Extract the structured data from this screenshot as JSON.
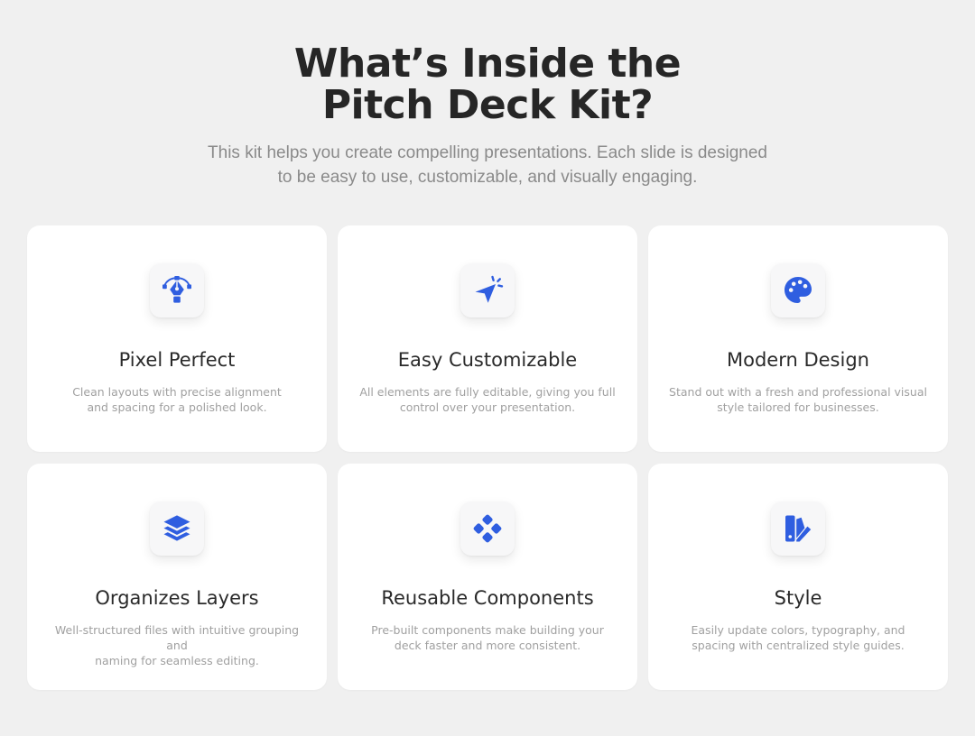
{
  "header": {
    "title_line1": "What’s Inside the",
    "title_line2": "Pitch Deck Kit?",
    "subtitle_line1": "This kit helps you create compelling presentations. Each slide is designed",
    "subtitle_line2": "to be easy to use, customizable, and visually engaging."
  },
  "colors": {
    "accent": "#2f5ee0",
    "background": "#f0f0f0",
    "card": "#ffffff",
    "title": "#262626",
    "muted": "#a0a0a0"
  },
  "features": [
    {
      "icon": "pen-tool-icon",
      "title": "Pixel Perfect",
      "desc_line1": "Clean layouts with precise alignment",
      "desc_line2": "and spacing for a polished look."
    },
    {
      "icon": "cursor-click-icon",
      "title": "Easy Customizable",
      "desc_line1": "All elements are fully editable, giving you full",
      "desc_line2": "control over your presentation."
    },
    {
      "icon": "palette-icon",
      "title": "Modern Design",
      "desc_line1": "Stand out with a fresh and professional visual",
      "desc_line2": "style tailored for businesses."
    },
    {
      "icon": "layers-icon",
      "title": "Organizes Layers",
      "desc_line1": "Well-structured files with intuitive grouping and",
      "desc_line2": "naming for seamless editing."
    },
    {
      "icon": "components-icon",
      "title": "Reusable Components",
      "desc_line1": "Pre-built components make building your",
      "desc_line2": "deck faster and more consistent."
    },
    {
      "icon": "swatches-icon",
      "title": "Style",
      "desc_line1": "Easily update colors, typography, and",
      "desc_line2": "spacing with centralized style guides."
    }
  ]
}
